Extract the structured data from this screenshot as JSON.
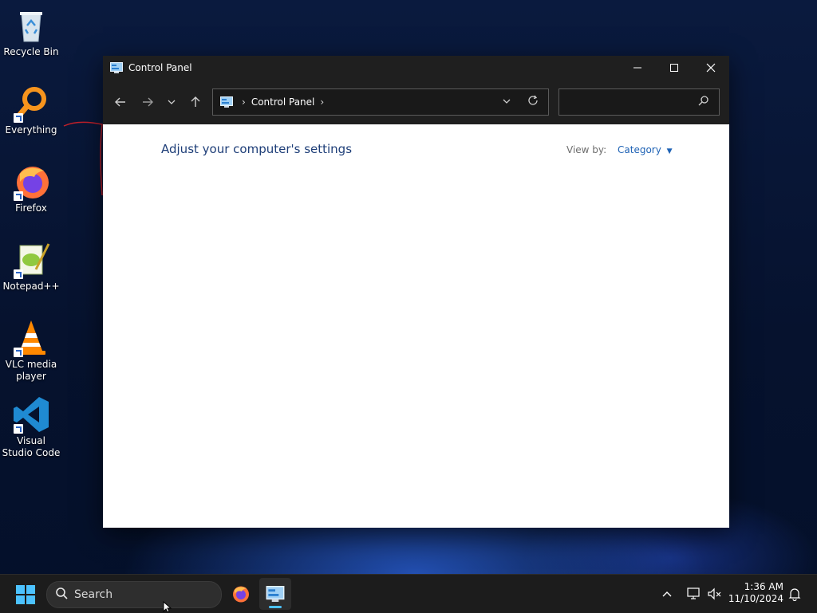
{
  "desktop": {
    "icons": [
      {
        "label": "Recycle Bin"
      },
      {
        "label": "Everything"
      },
      {
        "label": "Firefox"
      },
      {
        "label": "Notepad++"
      },
      {
        "label": "VLC media player"
      },
      {
        "label": "Visual Studio Code"
      }
    ]
  },
  "window": {
    "title": "Control Panel",
    "address": {
      "crumb": "Control Panel"
    },
    "search": {
      "value": "",
      "placeholder": ""
    },
    "content": {
      "heading": "Adjust your computer's settings",
      "view_by_label": "View by:",
      "view_by_value": "Category"
    }
  },
  "taskbar": {
    "search_label": "Search",
    "clock": {
      "time": "1:36 AM",
      "date": "11/10/2024"
    }
  },
  "colors": {
    "accent": "#4cc2ff",
    "link": "#1e62b5",
    "heading": "#1e3e78",
    "window_chrome": "#1f1f1f"
  }
}
